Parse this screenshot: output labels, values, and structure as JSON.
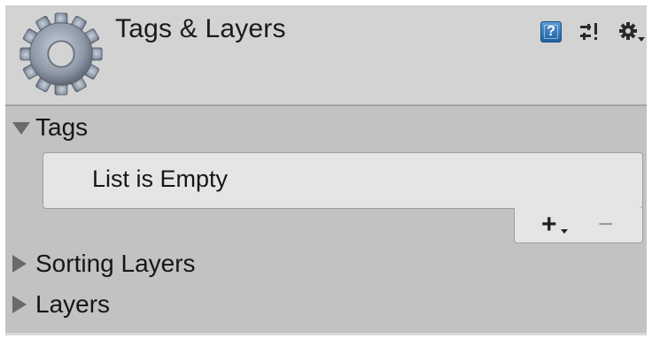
{
  "header": {
    "title": "Tags & Layers",
    "icons": {
      "main": "gear-icon",
      "help": "help-book-icon",
      "presets": "presets-sliders-icon",
      "settings": "settings-gear-menu-icon"
    },
    "help_glyph": "?"
  },
  "sections": {
    "tags": {
      "label": "Tags",
      "expanded": true,
      "empty_text": "List is Empty",
      "add_label": "+",
      "remove_label": "−"
    },
    "sorting_layers": {
      "label": "Sorting Layers",
      "expanded": false
    },
    "layers": {
      "label": "Layers",
      "expanded": false
    }
  },
  "colors": {
    "header_bg": "#d3d3d3",
    "content_bg": "#c2c2c2",
    "list_bg": "#e5e5e5",
    "foldout_arrow": "#6a6a6a",
    "help_icon": "#2f6fb5"
  }
}
